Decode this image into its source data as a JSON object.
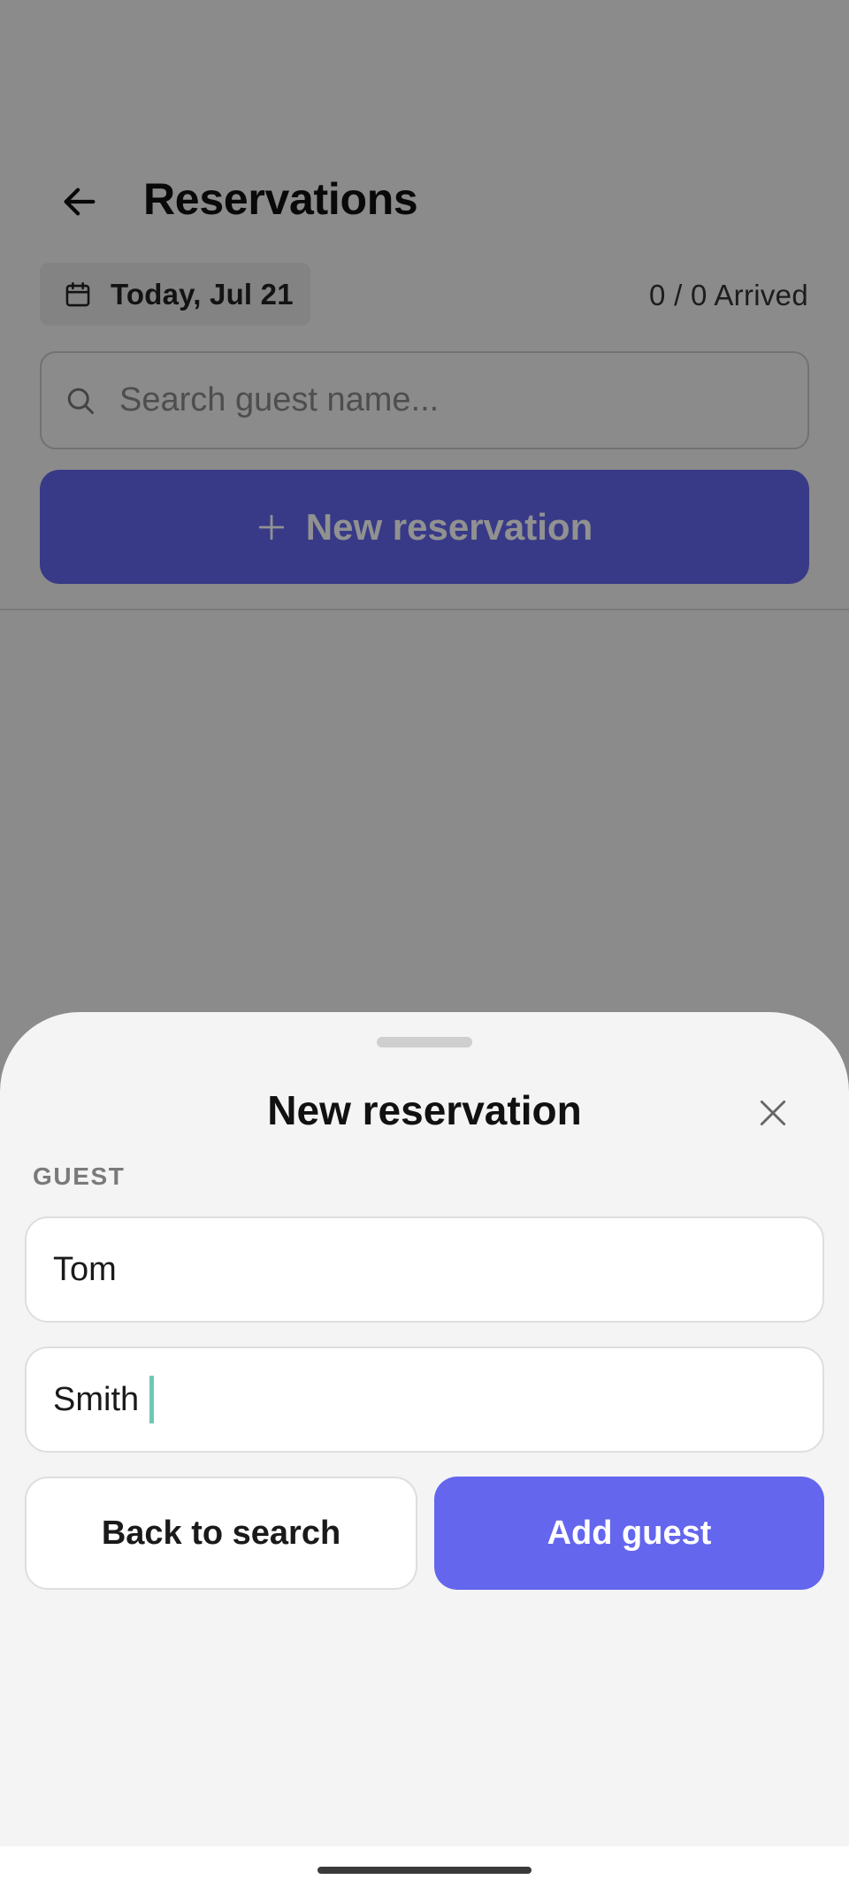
{
  "header": {
    "title": "Reservations",
    "back_icon": "arrow-left-icon"
  },
  "filters": {
    "date_label": "Today, Jul 21",
    "date_icon": "calendar-icon",
    "arrived_status": "0 / 0 Arrived"
  },
  "search": {
    "placeholder": "Search guest name...",
    "icon": "search-icon"
  },
  "new_reservation_button": {
    "label": "New reservation",
    "icon": "plus-icon"
  },
  "sheet": {
    "title": "New reservation",
    "close_icon": "close-icon",
    "section_label": "GUEST",
    "first_name_value": "Tom",
    "last_name_value": "Smith",
    "back_button_label": "Back to search",
    "add_button_label": "Add guest"
  },
  "colors": {
    "primary": "#6366EE",
    "caret": "#6FC8B6",
    "scrim": "rgba(0,0,0,0.43)"
  }
}
